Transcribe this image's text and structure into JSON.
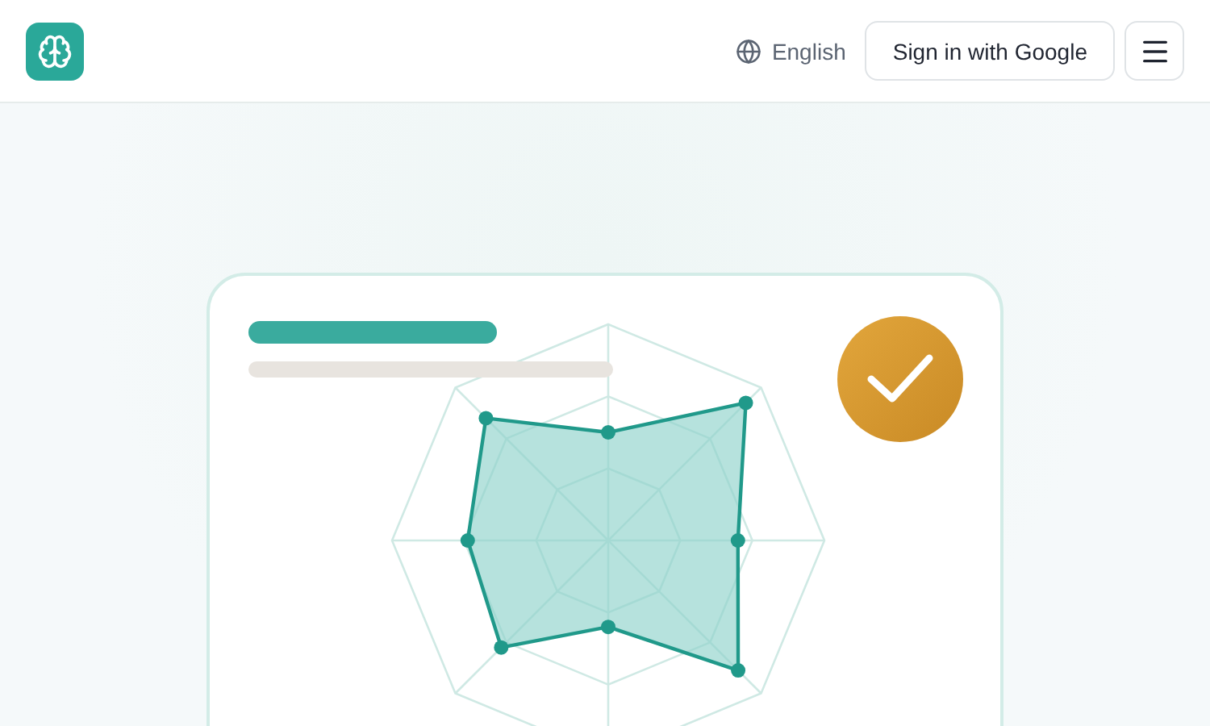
{
  "header": {
    "language": "English",
    "sign_in": "Sign in with Google"
  }
}
